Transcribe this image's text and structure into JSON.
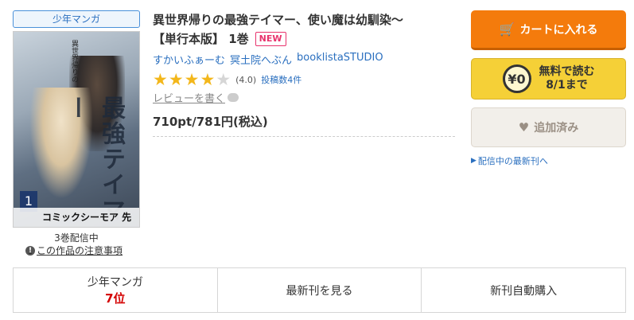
{
  "left": {
    "genre_badge": "少年マンガ",
    "cover": {
      "title_vertical": "最強テイマー",
      "subtitle": "異世界帰りの",
      "volume_number": "1",
      "band_text": "コミックシーモア 先行"
    },
    "volume_count": "3巻配信中",
    "caution_link": "この作品の注意事項",
    "caution_icon": "info-icon"
  },
  "product": {
    "title_line1": "異世界帰りの最強テイマー、使い魔は幼馴染〜",
    "title_line2": "【単行本版】 1巻",
    "new_badge": "NEW",
    "authors": [
      "すかいふぁーむ",
      "冥土院へぶん",
      "booklistaSTUDIO"
    ],
    "rating": 4,
    "rating_max": 5,
    "rating_text": "(4.0)",
    "review_count": "投稿数4件",
    "write_review": "レビューを書く",
    "price": "710pt/781円(税込)"
  },
  "actions": {
    "cart_button": "カートに入れる",
    "cart_icon": "cart-icon",
    "free_yen": "¥0",
    "free_line1": "無料で読む",
    "free_line2": "8/1まで",
    "added_button": "追加済み",
    "added_icon": "heart-icon",
    "latest_link": "配信中の最新刊へ"
  },
  "bottom_bar": {
    "ranking_label": "少年マンガ",
    "ranking_value": "7位",
    "latest_button": "最新刊を見る",
    "auto_purchase_button": "新刊自動購入"
  },
  "colors": {
    "accent_orange": "#f47b0c",
    "free_yellow": "#f5d037",
    "link_blue": "#2a6fbf",
    "new_pink": "#e8336d",
    "rank_red": "#d40000",
    "star_gold": "#f3b71b"
  }
}
